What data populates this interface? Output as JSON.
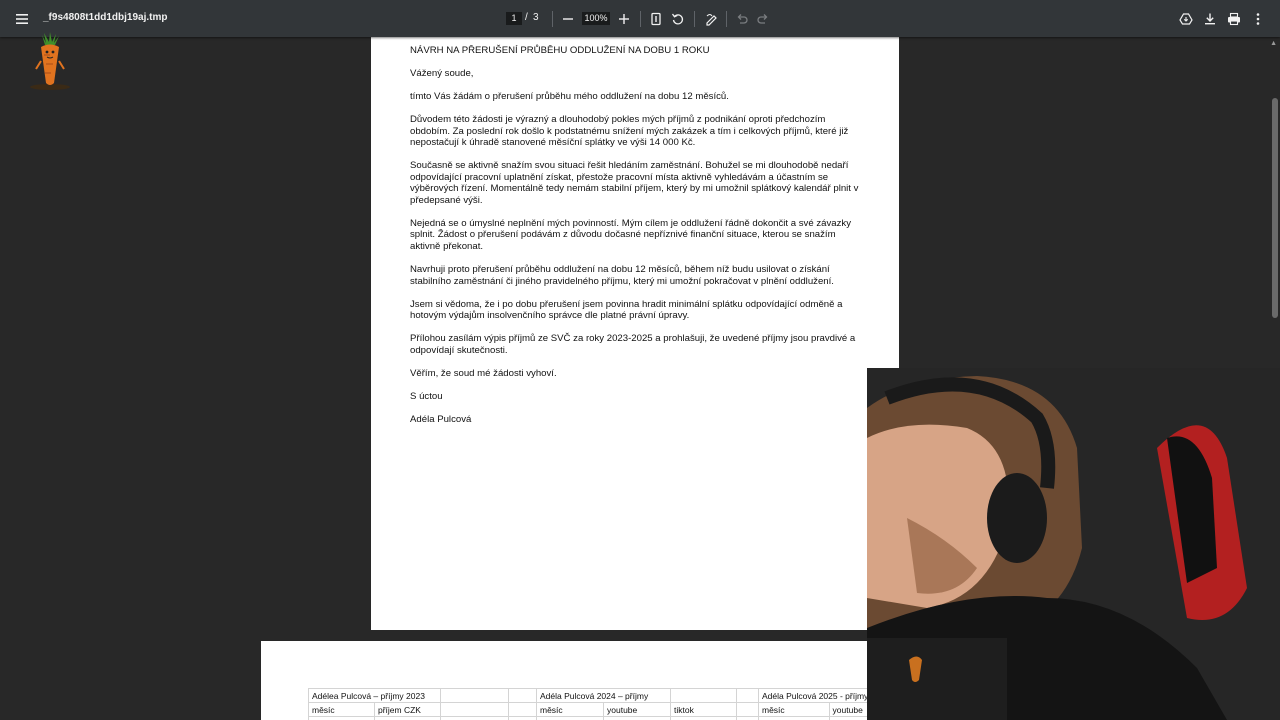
{
  "toolbar": {
    "filename": "_f9s4808t1dd1dbj19aj.tmp",
    "page_current": "1",
    "page_separator": "/",
    "page_total": "3",
    "zoom": "100%"
  },
  "document": {
    "heading": "NÁVRH NA PŘERUŠENÍ PRŮBĚHU ODDLUŽENÍ NA DOBU 1 ROKU",
    "greeting": "Vážený soude,",
    "paragraphs": [
      "tímto Vás žádám o přerušení průběhu mého oddlužení na dobu 12 měsíců.",
      "Důvodem této žádosti je výrazný a dlouhodobý pokles mých příjmů z podnikání oproti předchozím obdobím. Za poslední rok došlo k podstatnému snížení mých zakázek a tím i celkových příjmů, které již nepostačují k úhradě stanovené měsíční splátky ve výši 14 000 Kč.",
      "Současně se aktivně snažím svou situaci řešit hledáním zaměstnání. Bohužel se mi dlouhodobě nedaří odpovídající pracovní uplatnění získat, přestože pracovní místa aktivně vyhledávám a účastním se výběrových řízení. Momentálně tedy nemám stabilní příjem, který by mi umožnil splátkový kalendář plnit v předepsané výši.",
      "Nejedná se o úmyslné neplnění mých povinností. Mým cílem je oddlužení řádně dokončit a své závazky splnit. Žádost o přerušení podávám z důvodu dočasné nepříznivé finanční situace, kterou se snažím aktivně překonat.",
      "Navrhuji proto přerušení průběhu oddlužení na dobu 12 měsíců, během níž budu usilovat o získání stabilního zaměstnání či jiného pravidelného příjmu, který mi umožní pokračovat v plnění oddlužení.",
      "Jsem si vědoma, že i po dobu přerušení jsem povinna hradit minimální splátku odpovídající odměně a hotovým výdajům insolvenčního správce dle platné právní úpravy.",
      "Přílohou zasílám výpis příjmů ze SVČ za roky 2023-2025 a prohlašuji, že uvedené příjmy jsou pravdivé a odpovídají skutečnosti.",
      "Věřím, že soud mé žádosti vyhoví."
    ],
    "closing": "S úctou",
    "signature": "Adéla Pulcová"
  },
  "sheet": {
    "titles": [
      "Adélea Pulcová – příjmy 2023",
      "Adéla Pulcová 2024 – příjmy",
      "Adéla Pulcová 2025 - příjmy"
    ],
    "headers": [
      "měsíc",
      "příjem CZK",
      "měsíc",
      "youtube",
      "tiktok",
      "měsíc",
      "youtube"
    ]
  },
  "colors": {
    "toolbar_bg": "#323639",
    "viewer_bg": "#282828",
    "page_bg": "#ffffff"
  }
}
